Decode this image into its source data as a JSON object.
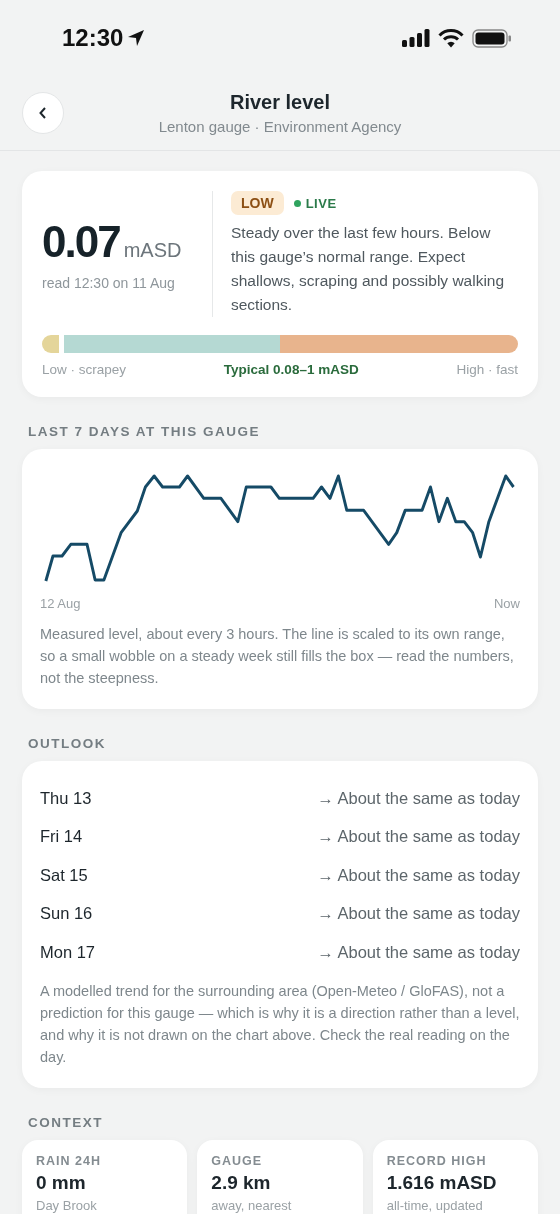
{
  "status_bar": {
    "time": "12:30"
  },
  "header": {
    "title": "River level",
    "subtitle": "Lenton gauge · Environment Agency"
  },
  "reading": {
    "value": "0.07",
    "unit": "mASD",
    "time": "read 12:30 on 11 Aug",
    "badge": "LOW",
    "live": {
      "label": "LIVE",
      "on": true
    },
    "summary": "Steady over the last few hours. Below this gauge’s normal range. Expect shallows, scraping and possibly walking sections.",
    "gauge": {
      "level": 0.035
    },
    "scale_low": "Low · scrapey",
    "scale_typical": "Typical 0.08–1 mASD",
    "scale_high": "High · fast"
  },
  "history": {
    "heading": "LAST 7 DAYS AT THIS GAUGE",
    "start_label": "12 Aug",
    "end_label": "Now",
    "note": "Measured level, about every 3 hours. The line is scaled to its own range, so a small wobble on a steady week still fills the box — read the numbers, not the steepness."
  },
  "outlook": {
    "heading": "OUTLOOK",
    "days": [
      {
        "day": "Thu 13",
        "trend": "→ About the same as today"
      },
      {
        "day": "Fri 14",
        "trend": "→ About the same as today"
      },
      {
        "day": "Sat 15",
        "trend": "→ About the same as today"
      },
      {
        "day": "Sun 16",
        "trend": "→ About the same as today"
      },
      {
        "day": "Mon 17",
        "trend": "→ About the same as today"
      }
    ],
    "note": "A modelled trend for the surrounding area (Open-Meteo / GloFAS), not a prediction for this gauge — which is why it is a direction rather than a level, and why it is not drawn on the chart above. Check the real reading on the day."
  },
  "context": {
    "heading": "CONTEXT",
    "cards": [
      {
        "label": "RAIN 24H",
        "value": "0 mm",
        "caption": "Day Brook"
      },
      {
        "label": "GAUGE",
        "value": "2.9 km",
        "caption": "away, nearest"
      },
      {
        "label": "RECORD HIGH",
        "value": "1.616 mASD",
        "caption": "all-time, updated"
      }
    ]
  }
}
